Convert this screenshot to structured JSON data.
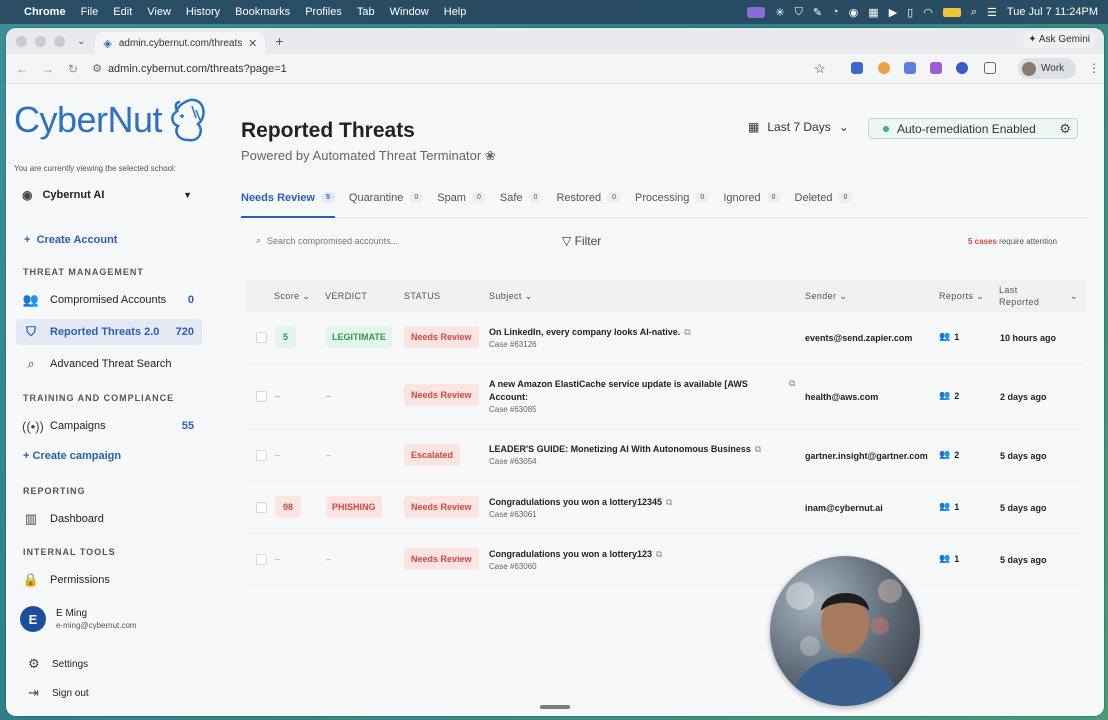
{
  "menubar": {
    "app": "Chrome",
    "items": [
      "File",
      "Edit",
      "View",
      "History",
      "Bookmarks",
      "Profiles",
      "Tab",
      "Window",
      "Help"
    ],
    "clock": "Tue Jul 7  11:24PM"
  },
  "browser": {
    "tab_title": "admin.cybernut.com/threats",
    "url": "admin.cybernut.com/threats?page=1",
    "gemini": "Ask Gemini",
    "profile": "Work"
  },
  "sidebar": {
    "logo_text": "CyberNut",
    "viewing_note": "You are currently viewing the selected school:",
    "school": "Cybernut AI",
    "create_account": "Create Account",
    "section_threat": "THREAT MANAGEMENT",
    "compromised": {
      "label": "Compromised Accounts",
      "count": "0"
    },
    "reported": {
      "label": "Reported Threats 2.0",
      "count": "720"
    },
    "advanced": {
      "label": "Advanced Threat Search"
    },
    "section_training": "TRAINING AND COMPLIANCE",
    "campaigns": {
      "label": "Campaigns",
      "count": "55"
    },
    "create_campaign": "+ Create campaign",
    "section_reporting": "REPORTING",
    "dashboard": {
      "label": "Dashboard"
    },
    "section_internal": "INTERNAL TOOLS",
    "permissions": {
      "label": "Permissions"
    },
    "user": {
      "initial": "E",
      "name": "E Ming",
      "email": "e-ming@cybernut.com"
    },
    "settings": "Settings",
    "signout": "Sign out"
  },
  "header": {
    "title": "Reported Threats",
    "subtitle": "Powered by Automated Threat Terminator",
    "date_range": "Last 7 Days",
    "auto_remediation": "Auto-remediation Enabled"
  },
  "tabs": [
    {
      "label": "Needs Review",
      "count": "5"
    },
    {
      "label": "Quarantine",
      "count": "0"
    },
    {
      "label": "Spam",
      "count": "0"
    },
    {
      "label": "Safe",
      "count": "0"
    },
    {
      "label": "Restored",
      "count": "0"
    },
    {
      "label": "Processing",
      "count": "0"
    },
    {
      "label": "Ignored",
      "count": "0"
    },
    {
      "label": "Deleted",
      "count": "0"
    }
  ],
  "toolbar": {
    "search_placeholder": "Search compromised accounts...",
    "filter": "Filter",
    "attention_count": "5 cases",
    "attention_text": " require attention"
  },
  "table": {
    "headers": {
      "score": "Score",
      "verdict": "VERDICT",
      "status": "STATUS",
      "subject": "Subject",
      "sender": "Sender",
      "reports": "Reports",
      "last_line1": "Last",
      "last_line2": "Reported"
    },
    "rows": [
      {
        "score": "5",
        "verdict": "LEGITIMATE",
        "status": "Needs Review",
        "subject": "On LinkedIn, every company looks AI-native.",
        "case": "Case #63126",
        "sender": "events@send.zapier.com",
        "reports": "1",
        "last": "10 hours ago"
      },
      {
        "score": "–",
        "verdict": "–",
        "status": "Needs Review",
        "subject": "A new Amazon ElastiCache service update is available [AWS Account:",
        "case": "Case #63085",
        "sender": "health@aws.com",
        "reports": "2",
        "last": "2 days ago"
      },
      {
        "score": "–",
        "verdict": "–",
        "status": "Escalated",
        "subject": "LEADER'S GUIDE: Monetizing AI With Autonomous Business",
        "case": "Case #63054",
        "sender": "gartner.insight@gartner.com",
        "reports": "2",
        "last": "5 days ago"
      },
      {
        "score": "98",
        "verdict": "PHISHING",
        "status": "Needs Review",
        "subject": "Congradulations you won a lottery12345",
        "case": "Case #63061",
        "sender": "inam@cybernut.ai",
        "reports": "1",
        "last": "5 days ago"
      },
      {
        "score": "–",
        "verdict": "–",
        "status": "Needs Review",
        "subject": "Congradulations you won a lottery123",
        "case": "Case #63060",
        "sender": "",
        "reports": "1",
        "last": "5 days ago"
      }
    ]
  }
}
